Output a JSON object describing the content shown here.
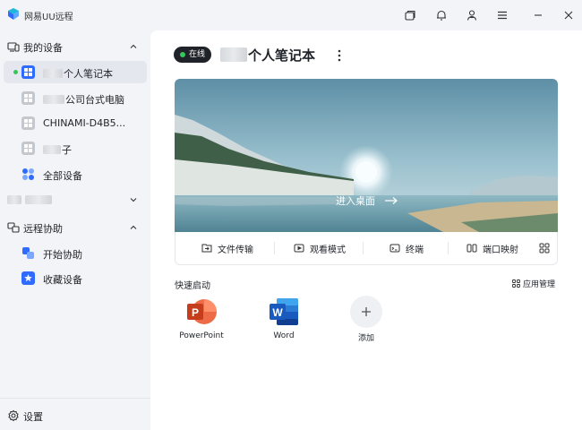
{
  "app": {
    "title": "网易UU远程"
  },
  "titlebar": {
    "icons": [
      "window-switch-icon",
      "bell-icon",
      "user-icon",
      "menu-icon",
      "minimize-icon",
      "close-icon"
    ]
  },
  "sidebar": {
    "my_devices": {
      "label": "我的设备",
      "items": [
        {
          "label": "个人笔记本",
          "online": true,
          "active": true
        },
        {
          "label": "公司台式电脑",
          "online": false
        },
        {
          "label": "CHINAMI-D4B5...",
          "online": false
        },
        {
          "label": "子",
          "online": false
        },
        {
          "label": "全部设备",
          "online": false
        }
      ]
    },
    "remote_assist": {
      "label": "远程协助",
      "items": [
        {
          "label": "开始协助"
        },
        {
          "label": "收藏设备"
        }
      ]
    },
    "settings_label": "设置"
  },
  "main": {
    "status": "在线",
    "device_name": "个人笔记本",
    "enter_desktop": "进入桌面",
    "toolbar": {
      "file_transfer": "文件传输",
      "watch_mode": "观看模式",
      "terminal": "终端",
      "port_mapping": "端口映射"
    },
    "quick_start": {
      "title": "快速启动",
      "app_manage": "应用管理",
      "apps": [
        {
          "label": "PowerPoint",
          "icon": "powerpoint-icon"
        },
        {
          "label": "Word",
          "icon": "word-icon"
        },
        {
          "label": "添加",
          "icon": "add-icon"
        }
      ]
    }
  },
  "colors": {
    "accent": "#2f6bff",
    "online": "#34c759",
    "sidebar_bg": "#f2f4f7",
    "active_item": "#e4e8ee",
    "powerpoint": "#d24726",
    "word": "#185abd"
  }
}
